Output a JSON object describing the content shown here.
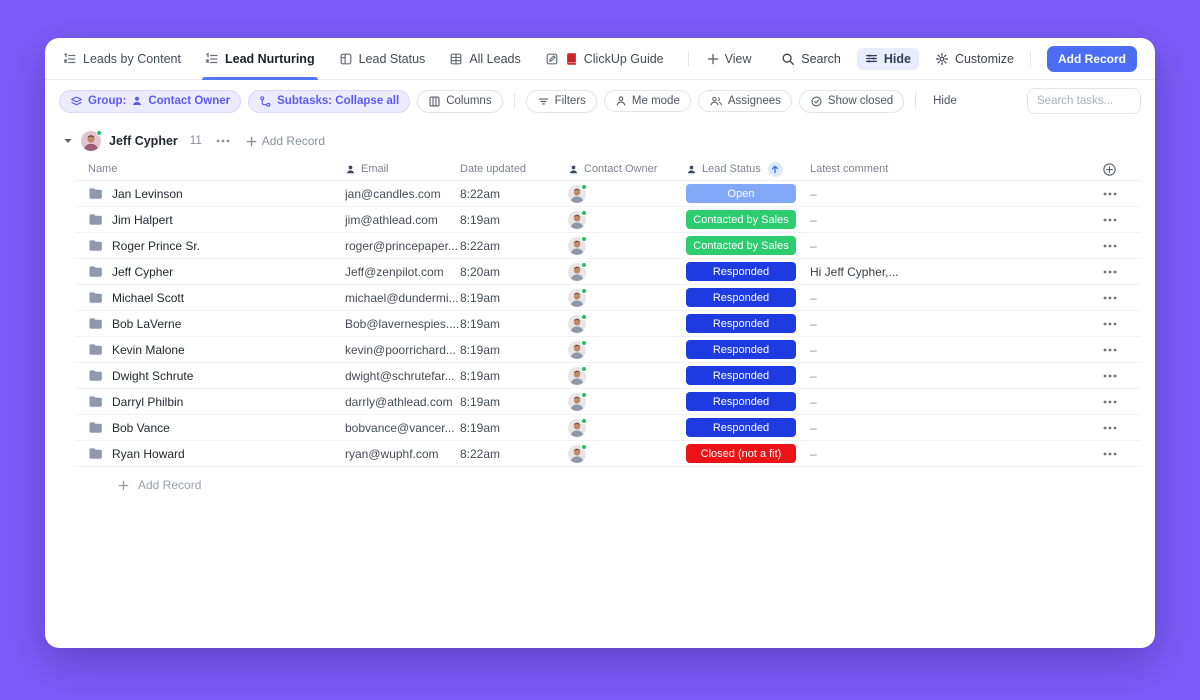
{
  "colors": {
    "background": "#7B5BF7",
    "accent_blue": "#4A6DF4",
    "active_tab_underline": "#5276F7"
  },
  "tabs": {
    "items": [
      {
        "label": "Leads by Content",
        "icon": "numbered-list-icon",
        "active": false
      },
      {
        "label": "Lead Nurturing",
        "icon": "numbered-list-icon",
        "active": true
      },
      {
        "label": "Lead Status",
        "icon": "board-icon",
        "active": false
      },
      {
        "label": "All Leads",
        "icon": "table-icon",
        "active": false
      },
      {
        "label": "ClickUp Guide",
        "icon": "doc-icon red-book-icon",
        "active": false
      }
    ],
    "add_view_label": "View"
  },
  "topbar": {
    "search_label": "Search",
    "hide_label": "Hide",
    "customize_label": "Customize",
    "add_record_label": "Add Record"
  },
  "toolbar": {
    "group_label": "Group:",
    "group_value": "Contact Owner",
    "subtasks_label": "Subtasks: Collapse all",
    "columns_label": "Columns",
    "filters_label": "Filters",
    "me_mode_label": "Me mode",
    "assignees_label": "Assignees",
    "show_closed_label": "Show closed",
    "hide_label": "Hide",
    "search_placeholder": "Search tasks..."
  },
  "group": {
    "name": "Jeff Cypher",
    "count": "11",
    "add_record_label": "Add Record"
  },
  "table": {
    "headers": {
      "name": "Name",
      "email": "Email",
      "date": "Date updated",
      "owner": "Contact Owner",
      "status": "Lead Status",
      "comment": "Latest comment"
    },
    "sort": {
      "column": "Lead Status",
      "direction": "asc"
    },
    "status_colors": {
      "Open": "#82A8F8",
      "Contacted by Sales": "#2DCC6E",
      "Responded": "#1E3BE1",
      "Closed (not a fit)": "#EB1317"
    },
    "rows": [
      {
        "name": "Jan Levinson",
        "email": "jan@candles.com",
        "date": "8:22am",
        "status": "Open",
        "comment": "–"
      },
      {
        "name": "Jim Halpert",
        "email": "jim@athlead.com",
        "date": "8:19am",
        "status": "Contacted by Sales",
        "comment": "–"
      },
      {
        "name": "Roger Prince Sr.",
        "email": "roger@princepaper...",
        "date": "8:22am",
        "status": "Contacted by Sales",
        "comment": "–"
      },
      {
        "name": "Jeff Cypher",
        "email": "Jeff@zenpilot.com",
        "date": "8:20am",
        "status": "Responded",
        "comment": "Hi Jeff Cypher,..."
      },
      {
        "name": "Michael Scott",
        "email": "michael@dundermi...",
        "date": "8:19am",
        "status": "Responded",
        "comment": "–"
      },
      {
        "name": "Bob LaVerne",
        "email": "Bob@lavernespies....",
        "date": "8:19am",
        "status": "Responded",
        "comment": "–"
      },
      {
        "name": "Kevin Malone",
        "email": "kevin@poorrichard...",
        "date": "8:19am",
        "status": "Responded",
        "comment": "–"
      },
      {
        "name": "Dwight Schrute",
        "email": "dwight@schrutefar...",
        "date": "8:19am",
        "status": "Responded",
        "comment": "–"
      },
      {
        "name": "Darryl Philbin",
        "email": "darrly@athlead.com",
        "date": "8:19am",
        "status": "Responded",
        "comment": "–"
      },
      {
        "name": "Bob Vance",
        "email": "bobvance@vancer...",
        "date": "8:19am",
        "status": "Responded",
        "comment": "–"
      },
      {
        "name": "Ryan Howard",
        "email": "ryan@wuphf.com",
        "date": "8:22am",
        "status": "Closed (not a fit)",
        "comment": "–"
      }
    ],
    "add_record_label": "Add Record"
  }
}
